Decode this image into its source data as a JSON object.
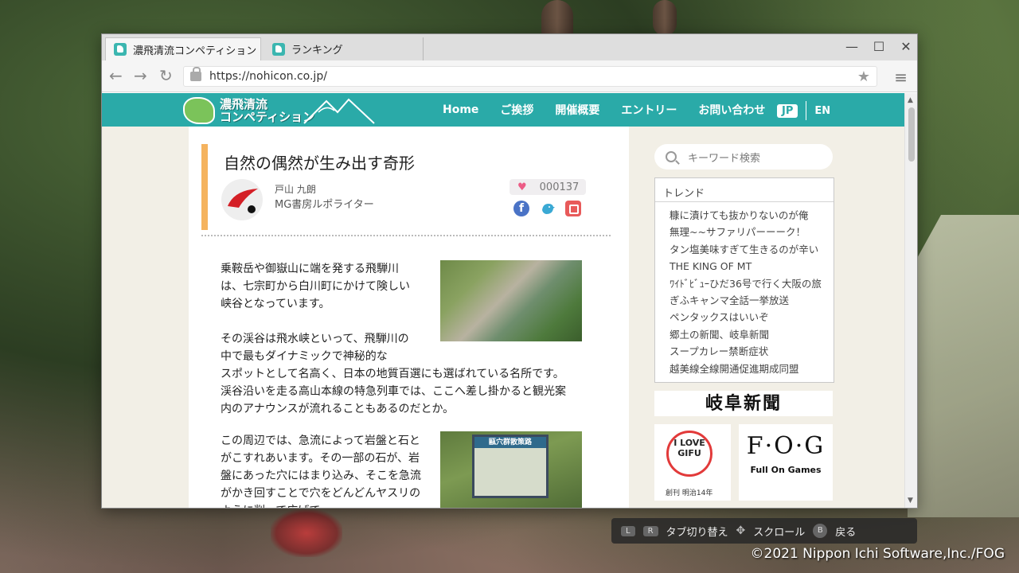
{
  "browser": {
    "tabs": [
      {
        "label": "濃飛清流コンペティション",
        "active": true
      },
      {
        "label": "ランキング",
        "active": false
      }
    ],
    "url": "https://nohicon.co.jp/",
    "window_controls": [
      "—",
      "☐",
      "✕"
    ]
  },
  "site": {
    "logo_line1": "濃飛清流",
    "logo_line2": "コンペティション",
    "nav": [
      "Home",
      "ご挨拶",
      "開催概要",
      "エントリー",
      "お問い合わせ"
    ],
    "lang_jp": "JP",
    "lang_en": "EN"
  },
  "article": {
    "title": "自然の偶然が生み出す奇形",
    "author_name": "戸山 九朗",
    "author_role": "MG書房ルポライター",
    "likes": "000137",
    "para1": "乗鞍岳や御嶽山に端を発する飛騨川は、七宗町から白川町にかけて険しい峡谷となっています。",
    "para2a": "その渓谷は飛水峡といって、飛騨川の中で最もダイナミックで神秘的な",
    "para2b": "スポットとして名高く、日本の地質百選にも選ばれている名所です。渓谷沿いを走る高山本線の特急列車では、ここへ差し掛かると観光案内のアナウンスが流れることもあるのだとか。",
    "para3": "この周辺では、急流によって岩盤と石とがこすれあいます。その一部の石が、岩盤にあった穴にはまり込み、そこを急流がかき回すことで穴をどんどんヤスリのように削って広げて",
    "sign_title": "甌穴群散策路"
  },
  "sidebar": {
    "search_placeholder": "キーワード検索",
    "trend_title": "トレンド",
    "trends": [
      "糠に漬けても抜かりないのが俺",
      "無理~~サファリパーーーク！",
      "タン塩美味すぎて生きるのが辛い",
      "THE KING OF MT",
      "ﾜｲﾄﾞﾋﾞｭｰひだ36号で行く大阪の旅",
      "ぎふキャンマ全話一挙放送",
      "ペンタックスはいいぞ",
      "郷土の新聞、岐阜新聞",
      "スープカレー禁断症状",
      "越美線全線開通促進期成同盟"
    ],
    "gifu_banner": "岐阜新聞",
    "ilove_text": "I LOVE GIFU",
    "ilove_sub": "創刊 明治14年",
    "fog_logo": "F·O·G",
    "fog_sub": "Full On Games"
  },
  "hints": {
    "key_l": "L",
    "key_r": "R",
    "tab_switch": "タブ切り替え",
    "scroll": "スクロール",
    "key_b": "B",
    "back": "戻る"
  },
  "copyright": "©2021 Nippon Ichi Software,Inc./FOG",
  "colors": {
    "header_teal": "#2aaaa8",
    "title_accent": "#f5b35e",
    "like_pink": "#ec5c86"
  }
}
